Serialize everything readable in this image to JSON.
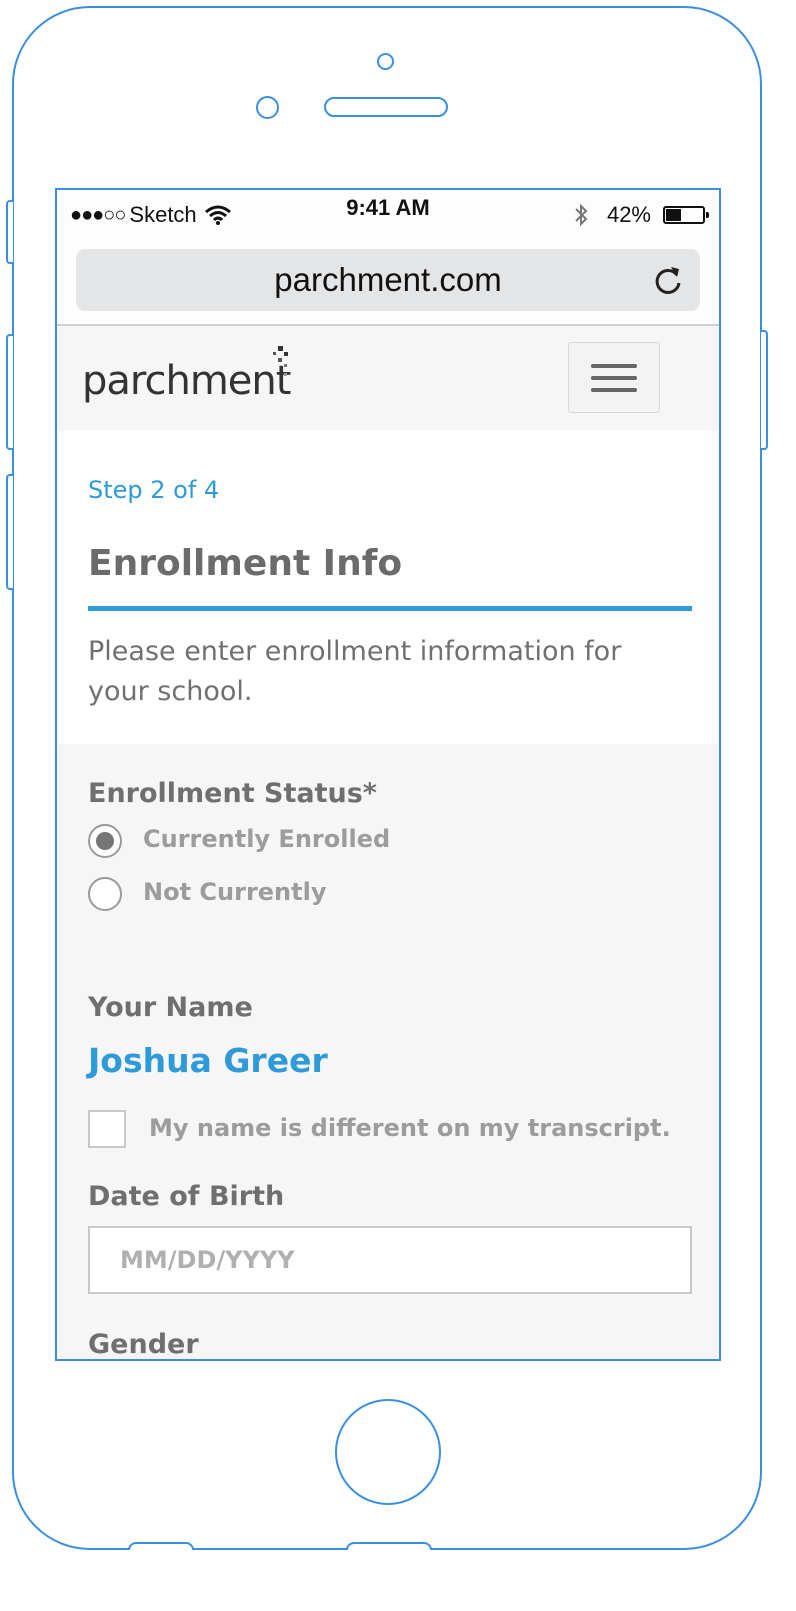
{
  "status_bar": {
    "signal": "●●●○○",
    "carrier": "Sketch",
    "time": "9:41 AM",
    "battery_percent": "42%",
    "battery_level": 0.42
  },
  "browser": {
    "url": "parchment.com",
    "reload_icon": "reload-icon"
  },
  "nav": {
    "logo_text": "parchment",
    "menu_icon": "hamburger-icon"
  },
  "page": {
    "step": "Step 2 of 4",
    "title": "Enrollment Info",
    "description": "Please enter enrollment information for your school."
  },
  "form": {
    "enrollment_status": {
      "label": "Enrollment Status*",
      "options": [
        "Currently Enrolled",
        "Not Currently"
      ],
      "selected": "Currently Enrolled"
    },
    "name": {
      "label": "Your Name",
      "value": "Joshua Greer",
      "different_checkbox_label": "My name is different on my transcript."
    },
    "dob": {
      "label": "Date of Birth",
      "placeholder": "MM/DD/YYYY"
    },
    "gender": {
      "label": "Gender"
    }
  },
  "colors": {
    "accent": "#2e9ad8",
    "device_outline": "#3b8fe3"
  }
}
